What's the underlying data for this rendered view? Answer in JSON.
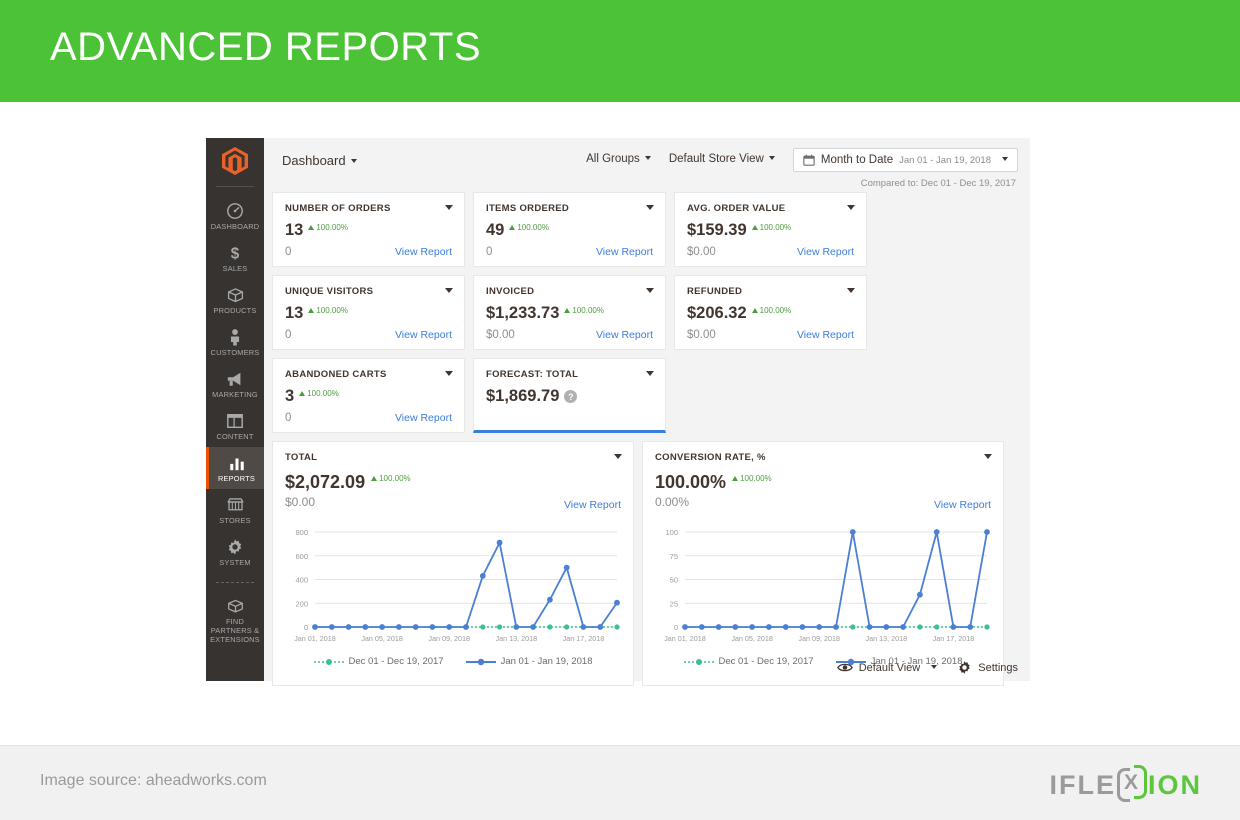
{
  "slide": {
    "title": "ADVANCED REPORTS",
    "source": "Image source: aheadworks.com",
    "brand": {
      "part1": "IFLE",
      "mark": "X",
      "part2": "ION",
      "grey": "#9b9b9b",
      "green": "#5cc63d"
    },
    "header_color": "#4cc336",
    "footer_color": "#f1f1f1"
  },
  "sidebar": {
    "logo": "magento-logo",
    "items": [
      {
        "label": "DASHBOARD",
        "icon": "gauge-icon",
        "active": false
      },
      {
        "label": "SALES",
        "icon": "dollar-icon",
        "active": false
      },
      {
        "label": "PRODUCTS",
        "icon": "box-icon",
        "active": false
      },
      {
        "label": "CUSTOMERS",
        "icon": "person-icon",
        "active": false
      },
      {
        "label": "MARKETING",
        "icon": "megaphone-icon",
        "active": false
      },
      {
        "label": "CONTENT",
        "icon": "layout-icon",
        "active": false
      },
      {
        "label": "REPORTS",
        "icon": "bar-chart-icon",
        "active": true
      },
      {
        "label": "STORES",
        "icon": "storefront-icon",
        "active": false
      },
      {
        "label": "SYSTEM",
        "icon": "gear-icon",
        "active": false
      },
      {
        "label": "FIND PARTNERS & EXTENSIONS",
        "icon": "package-icon",
        "active": false
      }
    ]
  },
  "topbar": {
    "breadcrumb": "Dashboard",
    "group_filter": "All Groups",
    "store_filter": "Default Store View",
    "daterange_label": "Month to Date",
    "daterange_value": "Jan 01 - Jan 19, 2018",
    "compared_to": "Compared to: Dec 01 - Dec 19, 2017"
  },
  "tiles": [
    {
      "title": "NUMBER OF ORDERS",
      "value": "13",
      "delta": "100.00%",
      "prev": "0",
      "link": "View Report",
      "accent": false
    },
    {
      "title": "ITEMS ORDERED",
      "value": "49",
      "delta": "100.00%",
      "prev": "0",
      "link": "View Report",
      "accent": false
    },
    {
      "title": "AVG. ORDER VALUE",
      "value": "$159.39",
      "delta": "100.00%",
      "prev": "$0.00",
      "link": "View Report",
      "accent": false
    },
    {
      "title": "UNIQUE VISITORS",
      "value": "13",
      "delta": "100.00%",
      "prev": "0",
      "link": "View Report",
      "accent": false
    },
    {
      "title": "INVOICED",
      "value": "$1,233.73",
      "delta": "100.00%",
      "prev": "$0.00",
      "link": "View Report",
      "accent": false
    },
    {
      "title": "REFUNDED",
      "value": "$206.32",
      "delta": "100.00%",
      "prev": "$0.00",
      "link": "View Report",
      "accent": false
    },
    {
      "title": "ABANDONED CARTS",
      "value": "3",
      "delta": "100.00%",
      "prev": "0",
      "link": "View Report",
      "accent": false
    },
    {
      "title": "FORECAST: TOTAL",
      "value": "$1,869.79",
      "delta": "",
      "prev": "",
      "link": "",
      "accent": true,
      "help": "?"
    }
  ],
  "panels": [
    {
      "title": "TOTAL",
      "value": "$2,072.09",
      "delta": "100.00%",
      "prev": "$0.00",
      "link": "View Report"
    },
    {
      "title": "CONVERSION RATE, %",
      "value": "100.00%",
      "delta": "100.00%",
      "prev": "0.00%",
      "link": "View Report"
    }
  ],
  "bottombar": {
    "view_label": "Default View",
    "settings_label": "Settings",
    "view_icon": "eye-icon",
    "settings_icon": "gear-icon"
  },
  "chart_data": [
    {
      "type": "line",
      "title": "TOTAL",
      "xlabel": "",
      "ylabel": "",
      "ylim": [
        0,
        800
      ],
      "yticks": [
        0,
        200,
        400,
        600,
        800
      ],
      "grid": true,
      "legend_position": "bottom",
      "x": [
        "Jan 01, 2018",
        "Jan 02, 2018",
        "Jan 03, 2018",
        "Jan 04, 2018",
        "Jan 05, 2018",
        "Jan 06, 2018",
        "Jan 07, 2018",
        "Jan 08, 2018",
        "Jan 09, 2018",
        "Jan 10, 2018",
        "Jan 11, 2018",
        "Jan 12, 2018",
        "Jan 13, 2018",
        "Jan 14, 2018",
        "Jan 15, 2018",
        "Jan 16, 2018",
        "Jan 17, 2018",
        "Jan 18, 2018",
        "Jan 19, 2018"
      ],
      "xtick_labels": [
        "Jan 01, 2018",
        "Jan 05, 2018",
        "Jan 09, 2018",
        "Jan 13, 2018",
        "Jan 17, 2018"
      ],
      "xtick_indices": [
        0,
        4,
        8,
        12,
        16
      ],
      "series": [
        {
          "name": "Dec 01 - Dec 19, 2017",
          "color": "#3dbf96",
          "style": "dotted",
          "values": [
            0,
            0,
            0,
            0,
            0,
            0,
            0,
            0,
            0,
            0,
            0,
            0,
            0,
            0,
            0,
            0,
            0,
            0,
            0
          ]
        },
        {
          "name": "Jan 01 - Jan 19, 2018",
          "color": "#4a7fd4",
          "style": "solid",
          "values": [
            0,
            0,
            0,
            0,
            0,
            0,
            0,
            0,
            0,
            0,
            430,
            710,
            0,
            0,
            230,
            500,
            0,
            0,
            205
          ]
        }
      ]
    },
    {
      "type": "line",
      "title": "CONVERSION RATE, %",
      "xlabel": "",
      "ylabel": "",
      "ylim": [
        0,
        100
      ],
      "yticks": [
        0,
        25,
        50,
        75,
        100
      ],
      "grid": true,
      "legend_position": "bottom",
      "x": [
        "Jan 01, 2018",
        "Jan 02, 2018",
        "Jan 03, 2018",
        "Jan 04, 2018",
        "Jan 05, 2018",
        "Jan 06, 2018",
        "Jan 07, 2018",
        "Jan 08, 2018",
        "Jan 09, 2018",
        "Jan 10, 2018",
        "Jan 11, 2018",
        "Jan 12, 2018",
        "Jan 13, 2018",
        "Jan 14, 2018",
        "Jan 15, 2018",
        "Jan 16, 2018",
        "Jan 17, 2018",
        "Jan 18, 2018",
        "Jan 19, 2018"
      ],
      "xtick_labels": [
        "Jan 01, 2018",
        "Jan 05, 2018",
        "Jan 09, 2018",
        "Jan 13, 2018",
        "Jan 17, 2018"
      ],
      "xtick_indices": [
        0,
        4,
        8,
        12,
        16
      ],
      "series": [
        {
          "name": "Dec 01 - Dec 19, 2017",
          "color": "#3dbf96",
          "style": "dotted",
          "values": [
            0,
            0,
            0,
            0,
            0,
            0,
            0,
            0,
            0,
            0,
            0,
            0,
            0,
            0,
            0,
            0,
            0,
            0,
            0
          ]
        },
        {
          "name": "Jan 01 - Jan 19, 2018",
          "color": "#4a7fd4",
          "style": "solid",
          "values": [
            0,
            0,
            0,
            0,
            0,
            0,
            0,
            0,
            0,
            0,
            100,
            0,
            0,
            0,
            34,
            100,
            0,
            0,
            100
          ]
        }
      ]
    }
  ]
}
